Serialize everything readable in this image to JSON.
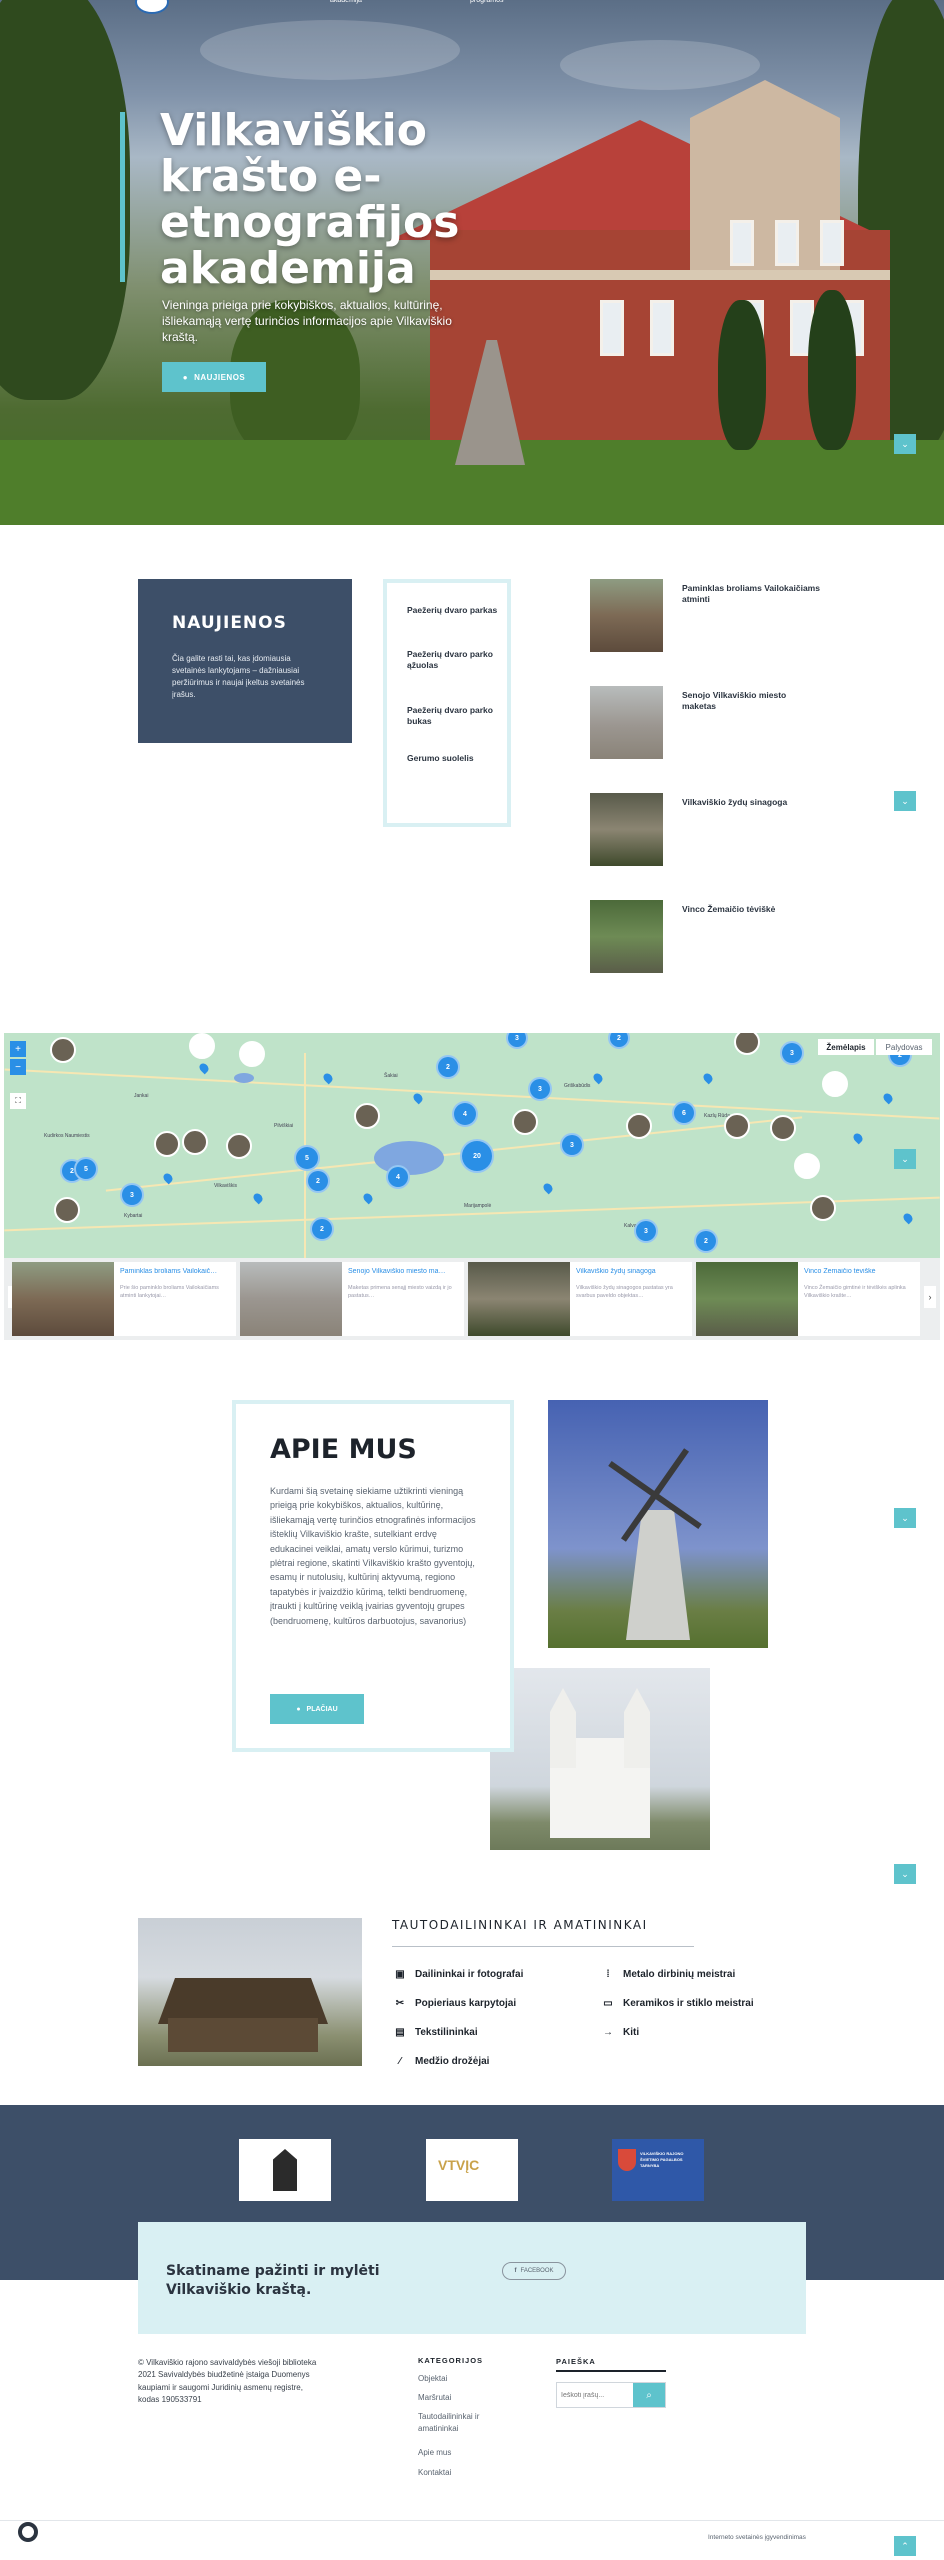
{
  "hero": {
    "nav_left": "akademija",
    "nav_right": "programos",
    "title": "Vilkaviškio krašto e-etnografijos akademija",
    "subtitle": "Vieninga prieiga prie kokybiškos, aktualios, kultūrinę, išliekamąją vertę turinčios informacijos apie Vilkaviškio kraštą.",
    "button_label": "NAUJIENOS"
  },
  "news": {
    "heading": "NAUJIENOS",
    "description": "Čia galite rasti tai, kas įdomiausia svetainės lankytojams – dažniausiai peržiūrimus ir naujai įkeltus svetainės įrašus.",
    "links": [
      "Paežerių dvaro parkas",
      "Paežerių dvaro parko ąžuolas",
      "Paežerių dvaro parko bukas",
      "Gerumo suolelis"
    ],
    "objects": [
      "Paminklas broliams Vailokaičiams atminti",
      "Senojo Vilkaviškio miesto maketas",
      "Vilkaviškio žydų sinagoga",
      "Vinco Žemaičio tėviškė"
    ]
  },
  "map": {
    "tab_map": "Žemėlapis",
    "tab_satellite": "Palydovas",
    "zoom_in": "+",
    "zoom_out": "−",
    "clusters": [
      "2",
      "3",
      "4",
      "2",
      "3",
      "5",
      "20",
      "4",
      "3",
      "6",
      "2",
      "3",
      "2",
      "2",
      "3",
      "2",
      "3",
      "5",
      "2"
    ],
    "places": [
      "Jankai",
      "Šakiai",
      "Griškabūdis",
      "Kudirkos Naumiestis",
      "Kybartai",
      "Vilkaviškis",
      "Marijampolė",
      "Kalvarija",
      "Pilviškiai",
      "Kazlų Rūda"
    ],
    "carousel": [
      {
        "title": "Paminklas broliams Vailokaič…",
        "desc": "Prie šio paminklo broliams Vailokaičiams atminti lankytojai…"
      },
      {
        "title": "Senojo Vilkaviškio miesto ma…",
        "desc": "Maketas primena senąjį miesto vaizdą ir jo pastatus…"
      },
      {
        "title": "Vilkaviškio žydų sinagoga",
        "desc": "Vilkaviškio žydų sinagogos pastatas yra svarbus paveldo objektas…"
      },
      {
        "title": "Vinco Žemaičio tėviškė",
        "desc": "Vinco Žemaičio gimtinė ir tėviškės aplinka Vilkaviškio krašte…"
      }
    ]
  },
  "about": {
    "heading": "APIE MUS",
    "text": "Kurdami šią svetainę siekiame užtikrinti vieningą prieigą prie kokybiškos, aktualios, kultūrinę, išliekamąją vertę turinčios etnografinės informacijos išteklių Vilkaviškio krašte, sutelkiant erdvę edukacinei veiklai, amatų verslo kūrimui, turizmo plėtrai regione, skatinti Vilkaviškio krašto gyventojų, esamų ir nutolusių, kultūrinį aktyvumą, regiono tapatybės ir įvaizdžio kūrimą, telkti bendruomenę, įtraukti į kultūrinę veiklą įvairias gyventojų grupes (bendruomenę, kultūros darbuotojus, savanorius)",
    "button_label": "PLAČIAU"
  },
  "crafts": {
    "heading": "TAUTODAILININKAI IR AMATININKAI",
    "items": [
      {
        "label": "Dailininkai ir fotografai",
        "icon": "palette-icon"
      },
      {
        "label": "Metalo dirbinių meistrai",
        "icon": "anvil-icon"
      },
      {
        "label": "Popieriaus karpytojai",
        "icon": "scissors-icon"
      },
      {
        "label": "Keramikos ir stiklo meistrai",
        "icon": "pottery-icon"
      },
      {
        "label": "Tekstilininkai",
        "icon": "loom-icon"
      },
      {
        "label": "Kiti",
        "icon": "arrow-right-icon"
      },
      {
        "label": "Medžio drožėjai",
        "icon": "chisel-icon"
      }
    ]
  },
  "partners": {
    "p2_text": "VTVĮC",
    "p3_text": "VILKAVIŠKIO RAJONO ŠVIETIMO PAGALBOS TARNYBA"
  },
  "cta": {
    "text": "Skatiname pažinti ir mylėti Vilkaviškio kraštą.",
    "facebook_label": "FACEBOOK"
  },
  "footer": {
    "copyright": "© Vilkaviškio rajono savivaldybės viešoji biblioteka 2021 Savivaldybės biudžetinė įstaiga Duomenys kaupiami ir saugomi Juridinių asmenų registre, kodas 190533791",
    "categories_heading": "KATEGORIJOS",
    "categories": [
      "Objektai",
      "Maršrutai",
      "Tautodailininkai ir amatininkai",
      "Apie mus",
      "Kontaktai"
    ],
    "search_heading": "PAIEŠKA",
    "search_placeholder": "Ieškoti įrašų...",
    "bottom_text": "Interneto svetainės įgyvendinimas"
  },
  "colors": {
    "accent": "#5ec3cc",
    "navy": "#3d4f68",
    "pale": "#d9f0f3",
    "map_blue": "#2a8fe6"
  }
}
